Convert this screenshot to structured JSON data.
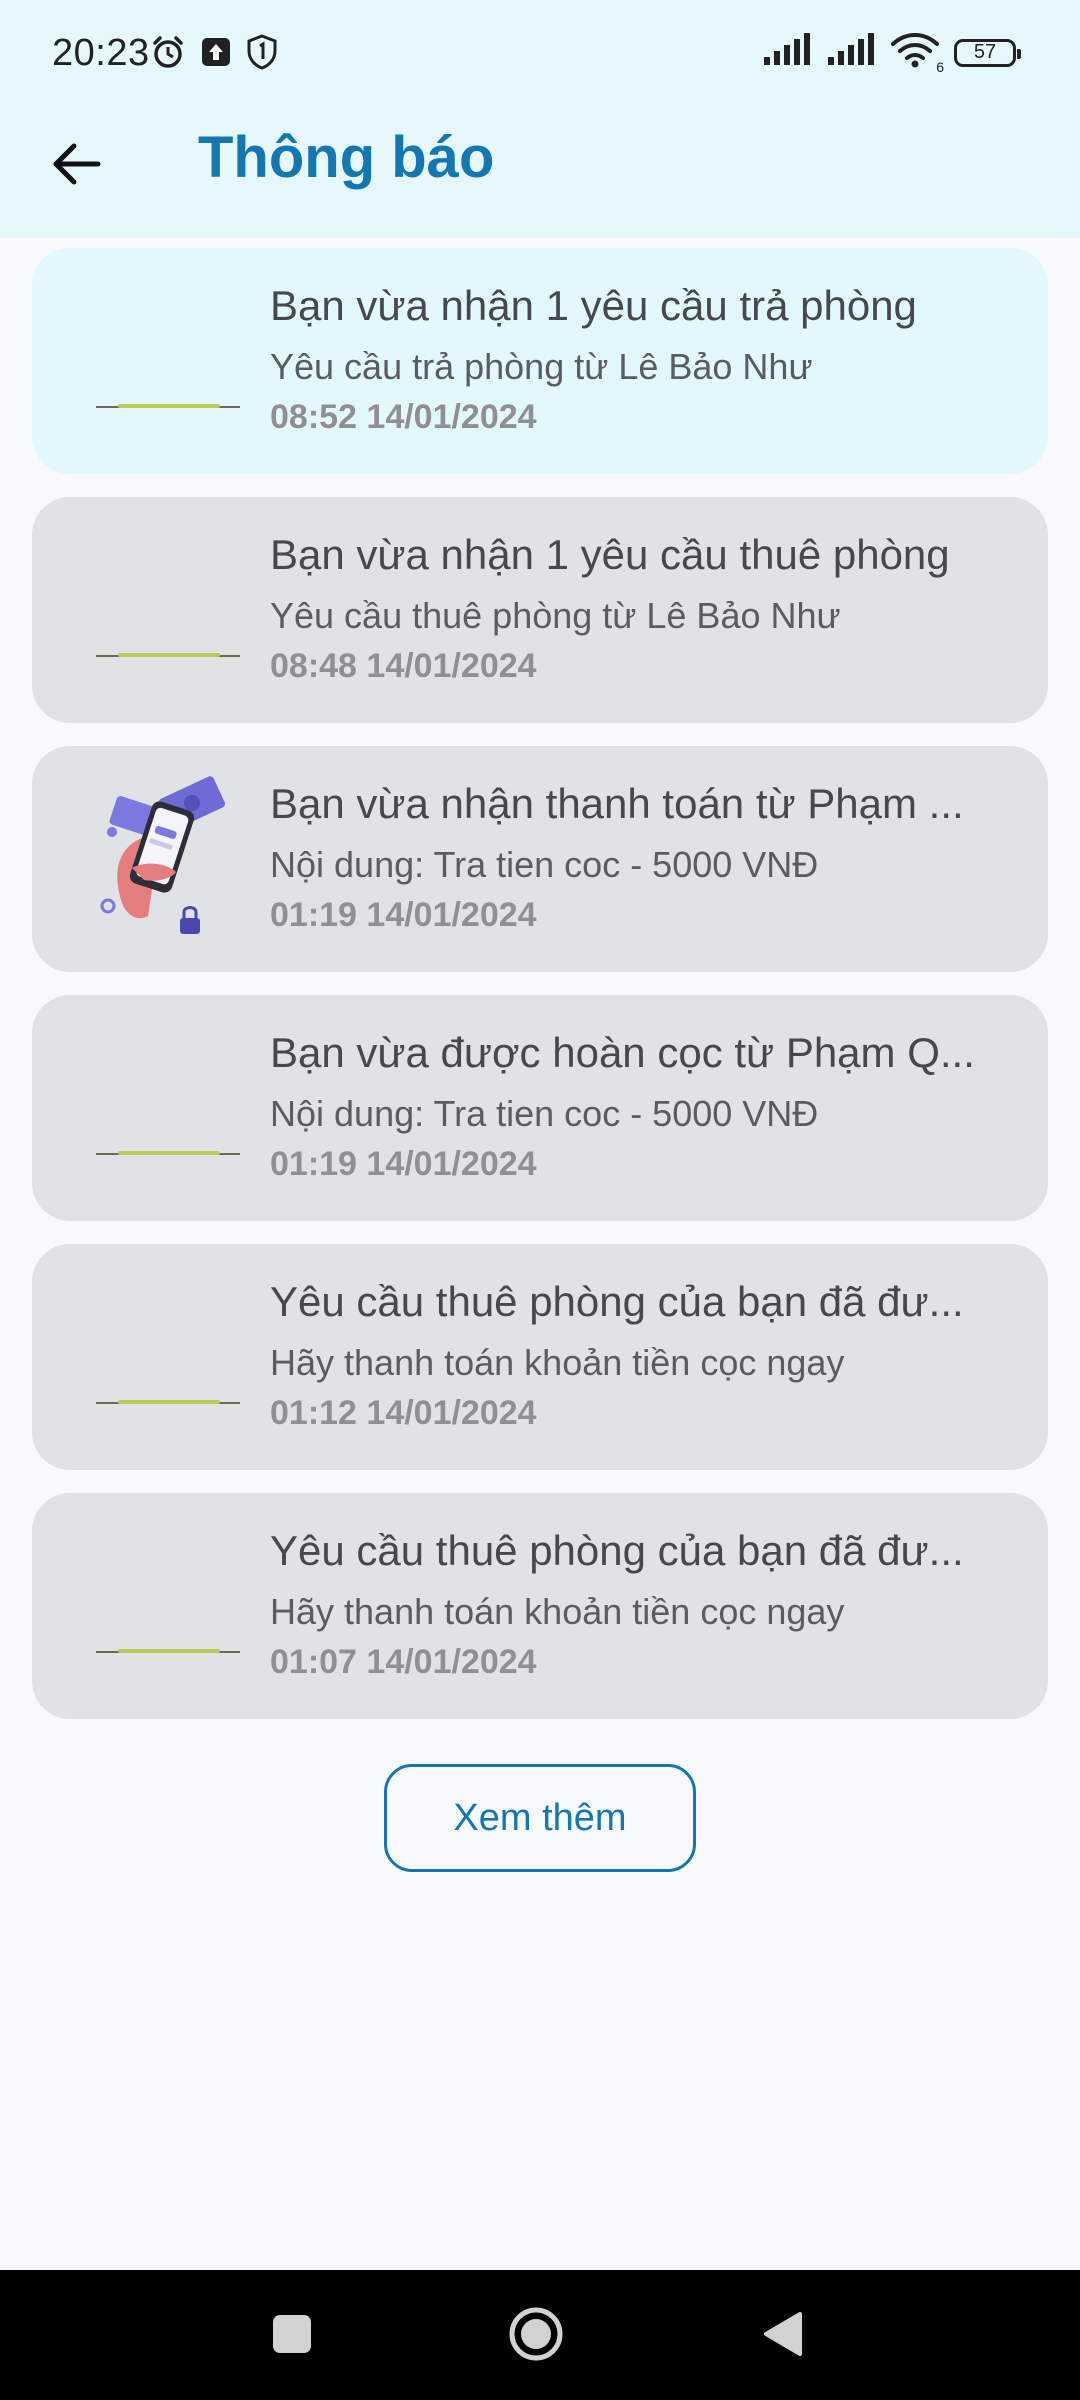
{
  "status_bar": {
    "time": "20:23",
    "battery": "57",
    "wifi_label": "6",
    "icons": [
      "alarm-icon",
      "upload-icon",
      "shield-icon",
      "signal-icon",
      "signal-icon",
      "wifi-icon",
      "battery-icon"
    ]
  },
  "header": {
    "title": "Thông báo",
    "back_icon": "arrow-left-icon"
  },
  "notifications": [
    {
      "title": "Bạn vừa nhận 1 yêu cầu trả phòng",
      "body": "Yêu cầu trả phòng từ Lê Bảo Như",
      "time": "08:52 14/01/2024",
      "unread": true,
      "thumbnail": "placeholder-line"
    },
    {
      "title": "Bạn vừa nhận 1 yêu cầu thuê phòng",
      "body": "Yêu cầu thuê phòng từ Lê Bảo Như",
      "time": "08:48 14/01/2024",
      "unread": false,
      "thumbnail": "placeholder-line"
    },
    {
      "title": "Bạn vừa nhận thanh toán từ Phạm ...",
      "body": "Nội dung: Tra tien coc - 5000 VNĐ",
      "time": "01:19 14/01/2024",
      "unread": false,
      "thumbnail": "payment-illustration"
    },
    {
      "title": "Bạn vừa được hoàn cọc từ Phạm Q...",
      "body": "Nội dung: Tra tien coc - 5000 VNĐ",
      "time": "01:19 14/01/2024",
      "unread": false,
      "thumbnail": "placeholder-line"
    },
    {
      "title": "Yêu cầu thuê phòng của bạn đã đư...",
      "body": "Hãy thanh toán khoản tiền cọc ngay",
      "time": "01:12 14/01/2024",
      "unread": false,
      "thumbnail": "placeholder-line"
    },
    {
      "title": "Yêu cầu thuê phòng của bạn đã đư...",
      "body": "Hãy thanh toán khoản tiền cọc ngay",
      "time": "01:07 14/01/2024",
      "unread": false,
      "thumbnail": "placeholder-line"
    }
  ],
  "more_button": {
    "label": "Xem thêm"
  },
  "navbar": {
    "icons": [
      "recents-square-icon",
      "home-circle-icon",
      "back-triangle-icon"
    ]
  },
  "colors": {
    "accent": "#1477b2",
    "header_bg": "#e6f8fd",
    "card_bg": "#e1e2e6",
    "unread_card_bg": "#e3f8fd"
  }
}
